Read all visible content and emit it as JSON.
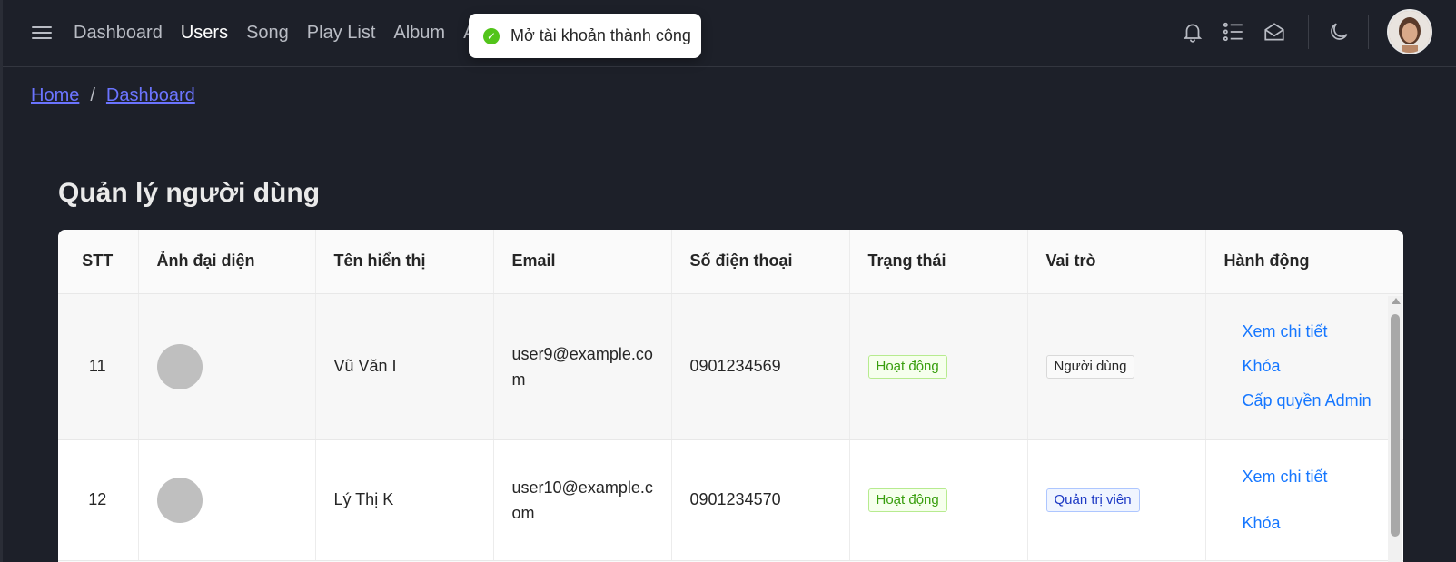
{
  "nav": {
    "items": [
      {
        "label": "Dashboard"
      },
      {
        "label": "Users"
      },
      {
        "label": "Song"
      },
      {
        "label": "Play List"
      },
      {
        "label": "Album"
      },
      {
        "label": "A"
      }
    ],
    "active": "Users"
  },
  "toast": {
    "message": "Mở tài khoản thành công",
    "icon": "check-circle-icon",
    "color": "#52c41a"
  },
  "header_icons": [
    "bell-icon",
    "list-icon",
    "mail-open-icon",
    "moon-icon"
  ],
  "breadcrumb": {
    "home": "Home",
    "separator": "/",
    "current": "Dashboard"
  },
  "page": {
    "title": "Quản lý người dùng"
  },
  "table": {
    "columns": [
      "STT",
      "Ảnh đại diện",
      "Tên hiển thị",
      "Email",
      "Số điện thoại",
      "Trạng thái",
      "Vai trò",
      "Hành động"
    ],
    "rows": [
      {
        "stt": "11",
        "name": "Vũ Văn I",
        "email_line1": "user9@example.co",
        "email_line2": "m",
        "phone": "0901234569",
        "status": "Hoạt động",
        "role": "Người dùng",
        "actions": [
          "Xem chi tiết",
          "Khóa",
          "Cấp quyền Admin"
        ]
      },
      {
        "stt": "12",
        "name": "Lý Thị K",
        "email_line1": "user10@example.c",
        "email_line2": "om",
        "phone": "0901234570",
        "status": "Hoạt động",
        "role": "Quản trị viên",
        "actions": [
          "Xem chi tiết",
          "Khóa"
        ]
      }
    ]
  },
  "colors": {
    "background": "#1d2029",
    "link": "#6b74ff",
    "action": "#1677ff",
    "status_green": "#389e0d"
  }
}
